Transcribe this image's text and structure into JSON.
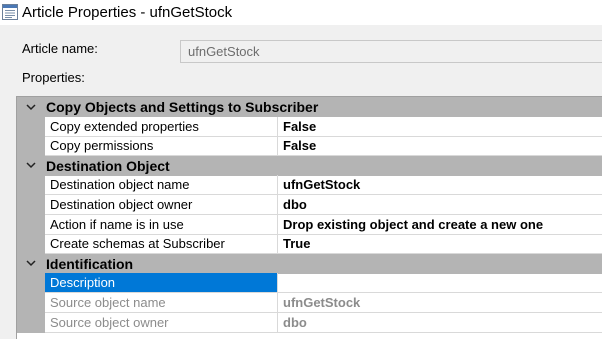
{
  "window": {
    "title": "Article Properties - ufnGetStock",
    "icon": "properties-window-icon"
  },
  "form": {
    "article_name_label": "Article name:",
    "article_name_value": "ufnGetStock",
    "properties_label": "Properties:"
  },
  "grid": {
    "categories": [
      {
        "title": "Copy Objects and Settings to Subscriber",
        "expanded": true,
        "properties": [
          {
            "name": "Copy extended properties",
            "value": "False"
          },
          {
            "name": "Copy permissions",
            "value": "False"
          }
        ]
      },
      {
        "title": "Destination Object",
        "expanded": true,
        "properties": [
          {
            "name": "Destination object name",
            "value": "ufnGetStock"
          },
          {
            "name": "Destination object owner",
            "value": "dbo"
          },
          {
            "name": "Action if name is in use",
            "value": "Drop existing object and create a new one"
          },
          {
            "name": "Create schemas at Subscriber",
            "value": "True"
          }
        ]
      },
      {
        "title": "Identification",
        "expanded": true,
        "properties": [
          {
            "name": "Description",
            "value": "",
            "selected": true
          },
          {
            "name": "Source object name",
            "value": "ufnGetStock",
            "disabled": true
          },
          {
            "name": "Source object owner",
            "value": "dbo",
            "disabled": true
          }
        ]
      }
    ]
  },
  "colors": {
    "category_header": "#b4b4b4",
    "selection": "#0078d7",
    "disabled_text": "#8c8c8c",
    "dialog_background": "#f0f0f0"
  }
}
